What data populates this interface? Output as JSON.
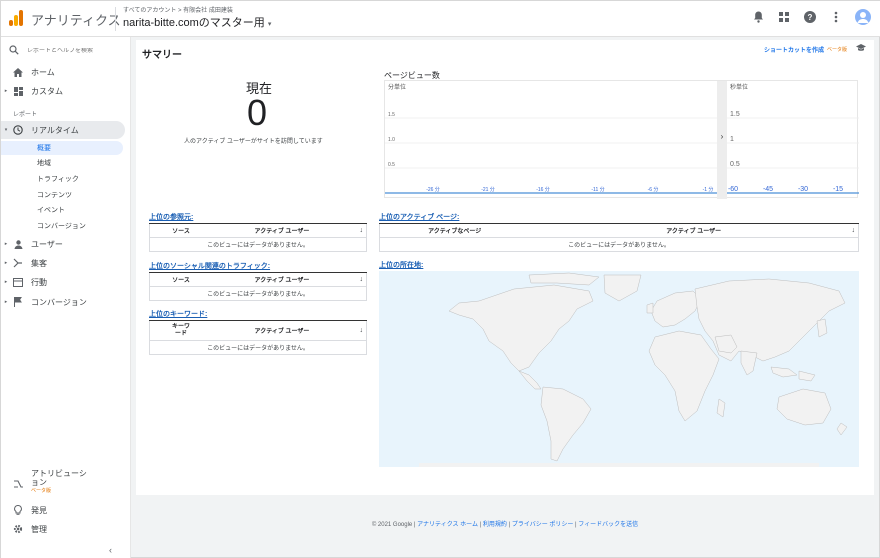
{
  "header": {
    "product_name": "アナリティクス",
    "breadcrumb": "すべてのアカウント > 有限会社 成田建装",
    "account_name": "narita-bitte.comのマスター用",
    "brand_colors": {
      "logo_dark": "#e37400",
      "logo_light": "#f9ab00",
      "avatar": "#8ab4f8"
    },
    "icons": [
      "bell-icon",
      "apps-grid-icon",
      "help-icon",
      "more-vert-icon",
      "account-avatar-icon"
    ]
  },
  "sidebar": {
    "search_placeholder": "レポートとヘルプを検索",
    "home": "ホーム",
    "custom": "カスタム",
    "reports_heading": "レポート",
    "realtime": "リアルタイム",
    "realtime_items": [
      "概要",
      "地域",
      "トラフィック",
      "コンテンツ",
      "イベント",
      "コンバージョン"
    ],
    "users": "ユーザー",
    "acquisition": "集客",
    "behavior": "行動",
    "conversions": "コンバージョン",
    "attribution": "アトリビューション",
    "attribution_beta": "ベータ版",
    "discover": "発見",
    "admin": "管理"
  },
  "main": {
    "page_title": "サマリー",
    "shortcut_label": "ショートカットを作成",
    "shortcut_beta": "ベータ版",
    "now_title": "現在",
    "now_value": "0",
    "now_desc": "人のアクティブ ユーザーがサイトを訪問しています",
    "pageviews_title": "ページビュー数",
    "per_minute_label": "分単位",
    "per_second_label": "秒単位",
    "widgets": {
      "referrals": {
        "title": "上位の参照元:",
        "col1": "ソース",
        "col2": "アクティブ ユーザー",
        "empty": "このビューにはデータがありません。"
      },
      "social": {
        "title": "上位のソーシャル関連のトラフィック:",
        "col1": "ソース",
        "col2": "アクティブ ユーザー",
        "empty": "このビューにはデータがありません。"
      },
      "keywords": {
        "title": "上位のキーワード:",
        "col1": "キーワード",
        "col2": "アクティブ ユーザー",
        "empty": "このビューにはデータがありません。"
      },
      "active_pages": {
        "title": "上位のアクティブ ページ:",
        "col1": "アクティブなページ",
        "col2": "アクティブ ユーザー",
        "empty": "このビューにはデータがありません。"
      },
      "locations": {
        "title": "上位の所在地:"
      }
    }
  },
  "chart_data": [
    {
      "type": "bar",
      "title": "分単位",
      "x": [
        "-26 分",
        "-21 分",
        "-16 分",
        "-11 分",
        "-6 分",
        "-1 分"
      ],
      "yticks": [
        "1.5",
        "1.0",
        "0.5"
      ],
      "values": [
        0,
        0,
        0,
        0,
        0,
        0
      ]
    },
    {
      "type": "bar",
      "title": "秒単位",
      "x": [
        "-60",
        "-45",
        "-30",
        "-15"
      ],
      "yticks": [
        "1.5",
        "1",
        "0.5"
      ],
      "values": [
        0,
        0,
        0,
        0
      ]
    }
  ],
  "footer": {
    "copyright": "© 2021 Google",
    "links": [
      "アナリティクス ホーム",
      "利用規約",
      "プライバシー ポリシー",
      "フィードバックを送信"
    ]
  }
}
